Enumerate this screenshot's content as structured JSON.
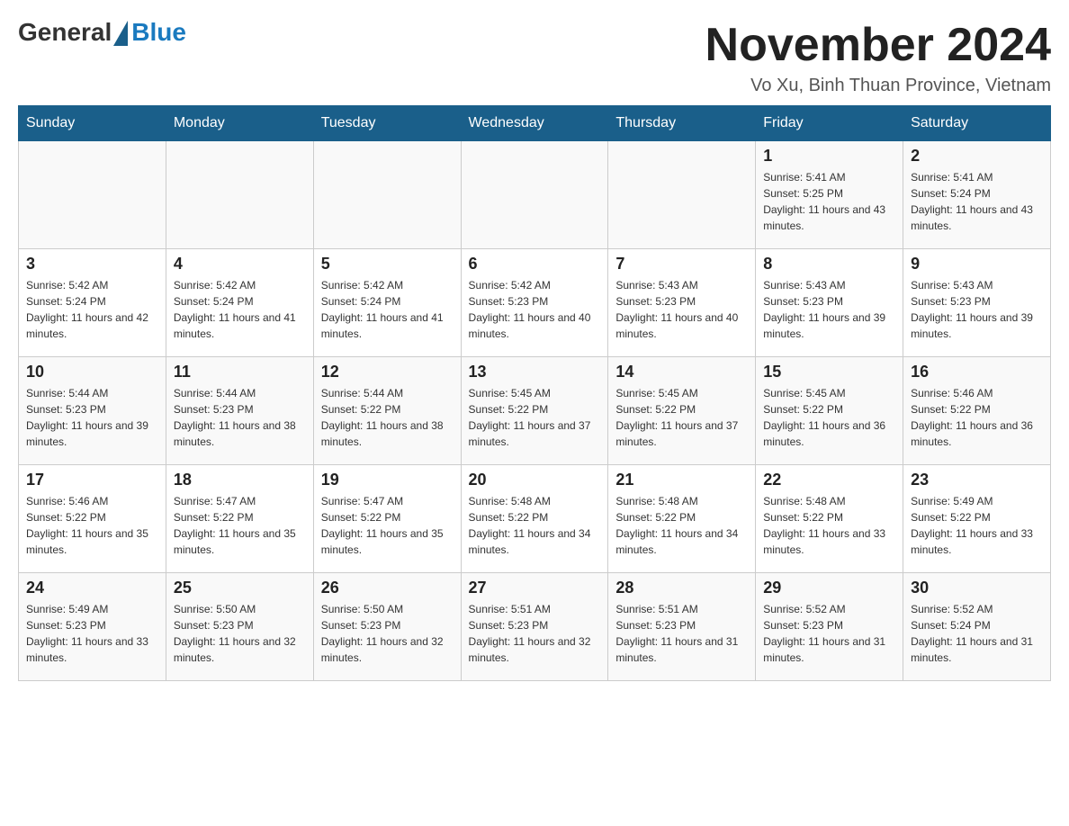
{
  "header": {
    "logo": {
      "general": "General",
      "blue": "Blue"
    },
    "title": "November 2024",
    "location": "Vo Xu, Binh Thuan Province, Vietnam"
  },
  "calendar": {
    "days_of_week": [
      "Sunday",
      "Monday",
      "Tuesday",
      "Wednesday",
      "Thursday",
      "Friday",
      "Saturday"
    ],
    "weeks": [
      [
        {
          "day": "",
          "info": ""
        },
        {
          "day": "",
          "info": ""
        },
        {
          "day": "",
          "info": ""
        },
        {
          "day": "",
          "info": ""
        },
        {
          "day": "",
          "info": ""
        },
        {
          "day": "1",
          "info": "Sunrise: 5:41 AM\nSunset: 5:25 PM\nDaylight: 11 hours and 43 minutes."
        },
        {
          "day": "2",
          "info": "Sunrise: 5:41 AM\nSunset: 5:24 PM\nDaylight: 11 hours and 43 minutes."
        }
      ],
      [
        {
          "day": "3",
          "info": "Sunrise: 5:42 AM\nSunset: 5:24 PM\nDaylight: 11 hours and 42 minutes."
        },
        {
          "day": "4",
          "info": "Sunrise: 5:42 AM\nSunset: 5:24 PM\nDaylight: 11 hours and 41 minutes."
        },
        {
          "day": "5",
          "info": "Sunrise: 5:42 AM\nSunset: 5:24 PM\nDaylight: 11 hours and 41 minutes."
        },
        {
          "day": "6",
          "info": "Sunrise: 5:42 AM\nSunset: 5:23 PM\nDaylight: 11 hours and 40 minutes."
        },
        {
          "day": "7",
          "info": "Sunrise: 5:43 AM\nSunset: 5:23 PM\nDaylight: 11 hours and 40 minutes."
        },
        {
          "day": "8",
          "info": "Sunrise: 5:43 AM\nSunset: 5:23 PM\nDaylight: 11 hours and 39 minutes."
        },
        {
          "day": "9",
          "info": "Sunrise: 5:43 AM\nSunset: 5:23 PM\nDaylight: 11 hours and 39 minutes."
        }
      ],
      [
        {
          "day": "10",
          "info": "Sunrise: 5:44 AM\nSunset: 5:23 PM\nDaylight: 11 hours and 39 minutes."
        },
        {
          "day": "11",
          "info": "Sunrise: 5:44 AM\nSunset: 5:23 PM\nDaylight: 11 hours and 38 minutes."
        },
        {
          "day": "12",
          "info": "Sunrise: 5:44 AM\nSunset: 5:22 PM\nDaylight: 11 hours and 38 minutes."
        },
        {
          "day": "13",
          "info": "Sunrise: 5:45 AM\nSunset: 5:22 PM\nDaylight: 11 hours and 37 minutes."
        },
        {
          "day": "14",
          "info": "Sunrise: 5:45 AM\nSunset: 5:22 PM\nDaylight: 11 hours and 37 minutes."
        },
        {
          "day": "15",
          "info": "Sunrise: 5:45 AM\nSunset: 5:22 PM\nDaylight: 11 hours and 36 minutes."
        },
        {
          "day": "16",
          "info": "Sunrise: 5:46 AM\nSunset: 5:22 PM\nDaylight: 11 hours and 36 minutes."
        }
      ],
      [
        {
          "day": "17",
          "info": "Sunrise: 5:46 AM\nSunset: 5:22 PM\nDaylight: 11 hours and 35 minutes."
        },
        {
          "day": "18",
          "info": "Sunrise: 5:47 AM\nSunset: 5:22 PM\nDaylight: 11 hours and 35 minutes."
        },
        {
          "day": "19",
          "info": "Sunrise: 5:47 AM\nSunset: 5:22 PM\nDaylight: 11 hours and 35 minutes."
        },
        {
          "day": "20",
          "info": "Sunrise: 5:48 AM\nSunset: 5:22 PM\nDaylight: 11 hours and 34 minutes."
        },
        {
          "day": "21",
          "info": "Sunrise: 5:48 AM\nSunset: 5:22 PM\nDaylight: 11 hours and 34 minutes."
        },
        {
          "day": "22",
          "info": "Sunrise: 5:48 AM\nSunset: 5:22 PM\nDaylight: 11 hours and 33 minutes."
        },
        {
          "day": "23",
          "info": "Sunrise: 5:49 AM\nSunset: 5:22 PM\nDaylight: 11 hours and 33 minutes."
        }
      ],
      [
        {
          "day": "24",
          "info": "Sunrise: 5:49 AM\nSunset: 5:23 PM\nDaylight: 11 hours and 33 minutes."
        },
        {
          "day": "25",
          "info": "Sunrise: 5:50 AM\nSunset: 5:23 PM\nDaylight: 11 hours and 32 minutes."
        },
        {
          "day": "26",
          "info": "Sunrise: 5:50 AM\nSunset: 5:23 PM\nDaylight: 11 hours and 32 minutes."
        },
        {
          "day": "27",
          "info": "Sunrise: 5:51 AM\nSunset: 5:23 PM\nDaylight: 11 hours and 32 minutes."
        },
        {
          "day": "28",
          "info": "Sunrise: 5:51 AM\nSunset: 5:23 PM\nDaylight: 11 hours and 31 minutes."
        },
        {
          "day": "29",
          "info": "Sunrise: 5:52 AM\nSunset: 5:23 PM\nDaylight: 11 hours and 31 minutes."
        },
        {
          "day": "30",
          "info": "Sunrise: 5:52 AM\nSunset: 5:24 PM\nDaylight: 11 hours and 31 minutes."
        }
      ]
    ]
  }
}
